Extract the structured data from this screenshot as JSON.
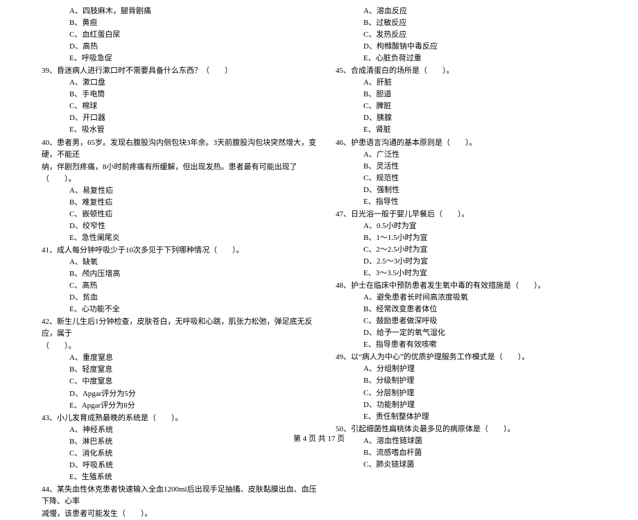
{
  "left": {
    "pre_opts": [
      "A、四肢麻木，腿背剧痛",
      "B、黄疸",
      "C、血红蛋白尿",
      "D、高热",
      "E、呼吸急促"
    ],
    "q39": {
      "stem": "39、昏迷病人进行漱口时不需要具备什么东西？（　　）",
      "opts": [
        "A、漱口盘",
        "B、手电筒",
        "C、棉球",
        "D、开口器",
        "E、吸水管"
      ]
    },
    "q40": {
      "stem_l1": "40、患者男，65岁。发现右腹股沟内侧包块3年余。3天前腹股沟包块突然增大，变硬，不能还",
      "stem_l2": "纳，伴剧烈疼痛，8小时前疼痛有所缓解，但出现发热。患者最有可能出现了（　　）。",
      "opts": [
        "A、易复性疝",
        "B、难复性疝",
        "C、嵌顿性疝",
        "D、绞窄性",
        "E、急性阑尾炎"
      ]
    },
    "q41": {
      "stem": "41、成人每分钟呼吸少于10次多见于下列哪种情况（　　）。",
      "opts": [
        "A、缺氧",
        "B、颅内压增高",
        "C、高热",
        "D、贫血",
        "E、心功能不全"
      ]
    },
    "q42": {
      "stem_l1": "42、新生儿生后1分钟检查，皮肤苍白，无呼吸和心跳，肌张力松弛，弹足底无反应，属于",
      "stem_l2": "（　　）。",
      "opts": [
        "A、重度窒息",
        "B、轻度窒息",
        "C、中度窒息",
        "D、Apgar评分为5分",
        "E、Apgar评分为8分"
      ]
    },
    "q43": {
      "stem": "43、小儿发育成熟最晚的系统是（　　）。",
      "opts": [
        "A、神经系统",
        "B、淋巴系统",
        "C、消化系统",
        "D、呼吸系统",
        "E、生殖系统"
      ]
    },
    "q44": {
      "stem_l1": "44、某失血性休克患者快速输入全血1200ml后出现手足抽搐、皮肤黏膜出血、血压下降、心率",
      "stem_l2": "减慢，该患者可能发生（　　）。"
    }
  },
  "right": {
    "pre_opts": [
      "A、溶血反应",
      "B、过敏反应",
      "C、发热反应",
      "D、枸橼酸钠中毒反应",
      "E、心脏负荷过重"
    ],
    "q45": {
      "stem": "45、合成清蛋白的场所是（　　）。",
      "opts": [
        "A、肝脏",
        "B、胆道",
        "C、脾脏",
        "D、胰腺",
        "E、肾脏"
      ]
    },
    "q46": {
      "stem": "46、护患语言沟通的基本原则是（　　）。",
      "opts": [
        "A、广泛性",
        "B、灵活性",
        "C、规范性",
        "D、强制性",
        "E、指导性"
      ]
    },
    "q47": {
      "stem": "47、日光浴一般于婴儿早餐后（　　）。",
      "opts": [
        "A、0.5小时为宜",
        "B、1～1.5小时为宜",
        "C、2～2.5小时为宜",
        "D、2.5～3小时为宜",
        "E、3～3.5小时为宜"
      ]
    },
    "q48": {
      "stem": "48、护士在临床中预防患者发生氧中毒的有效措施是（　　）。",
      "opts": [
        "A、避免患者长时间高浓度吸氧",
        "B、经常改变患者体位",
        "C、鼓励患者做深呼吸",
        "D、给予一定的氧气湿化",
        "E、指导患者有效咳嗽"
      ]
    },
    "q49": {
      "stem": "49、以“病人为中心”的优质护理服务工作模式是（　　）。",
      "opts": [
        "A、分组制护理",
        "B、分级制护理",
        "C、分层制护理",
        "D、功能制护理",
        "E、责任制整体护理"
      ]
    },
    "q50": {
      "stem": "50、引起细菌性扁桃体炎最多见的病原体是（　　）。",
      "opts": [
        "A、溶血性链球菌",
        "B、流感嗜血杆菌",
        "C、肺炎链球菌"
      ]
    }
  },
  "footer": "第 4 页 共 17 页"
}
